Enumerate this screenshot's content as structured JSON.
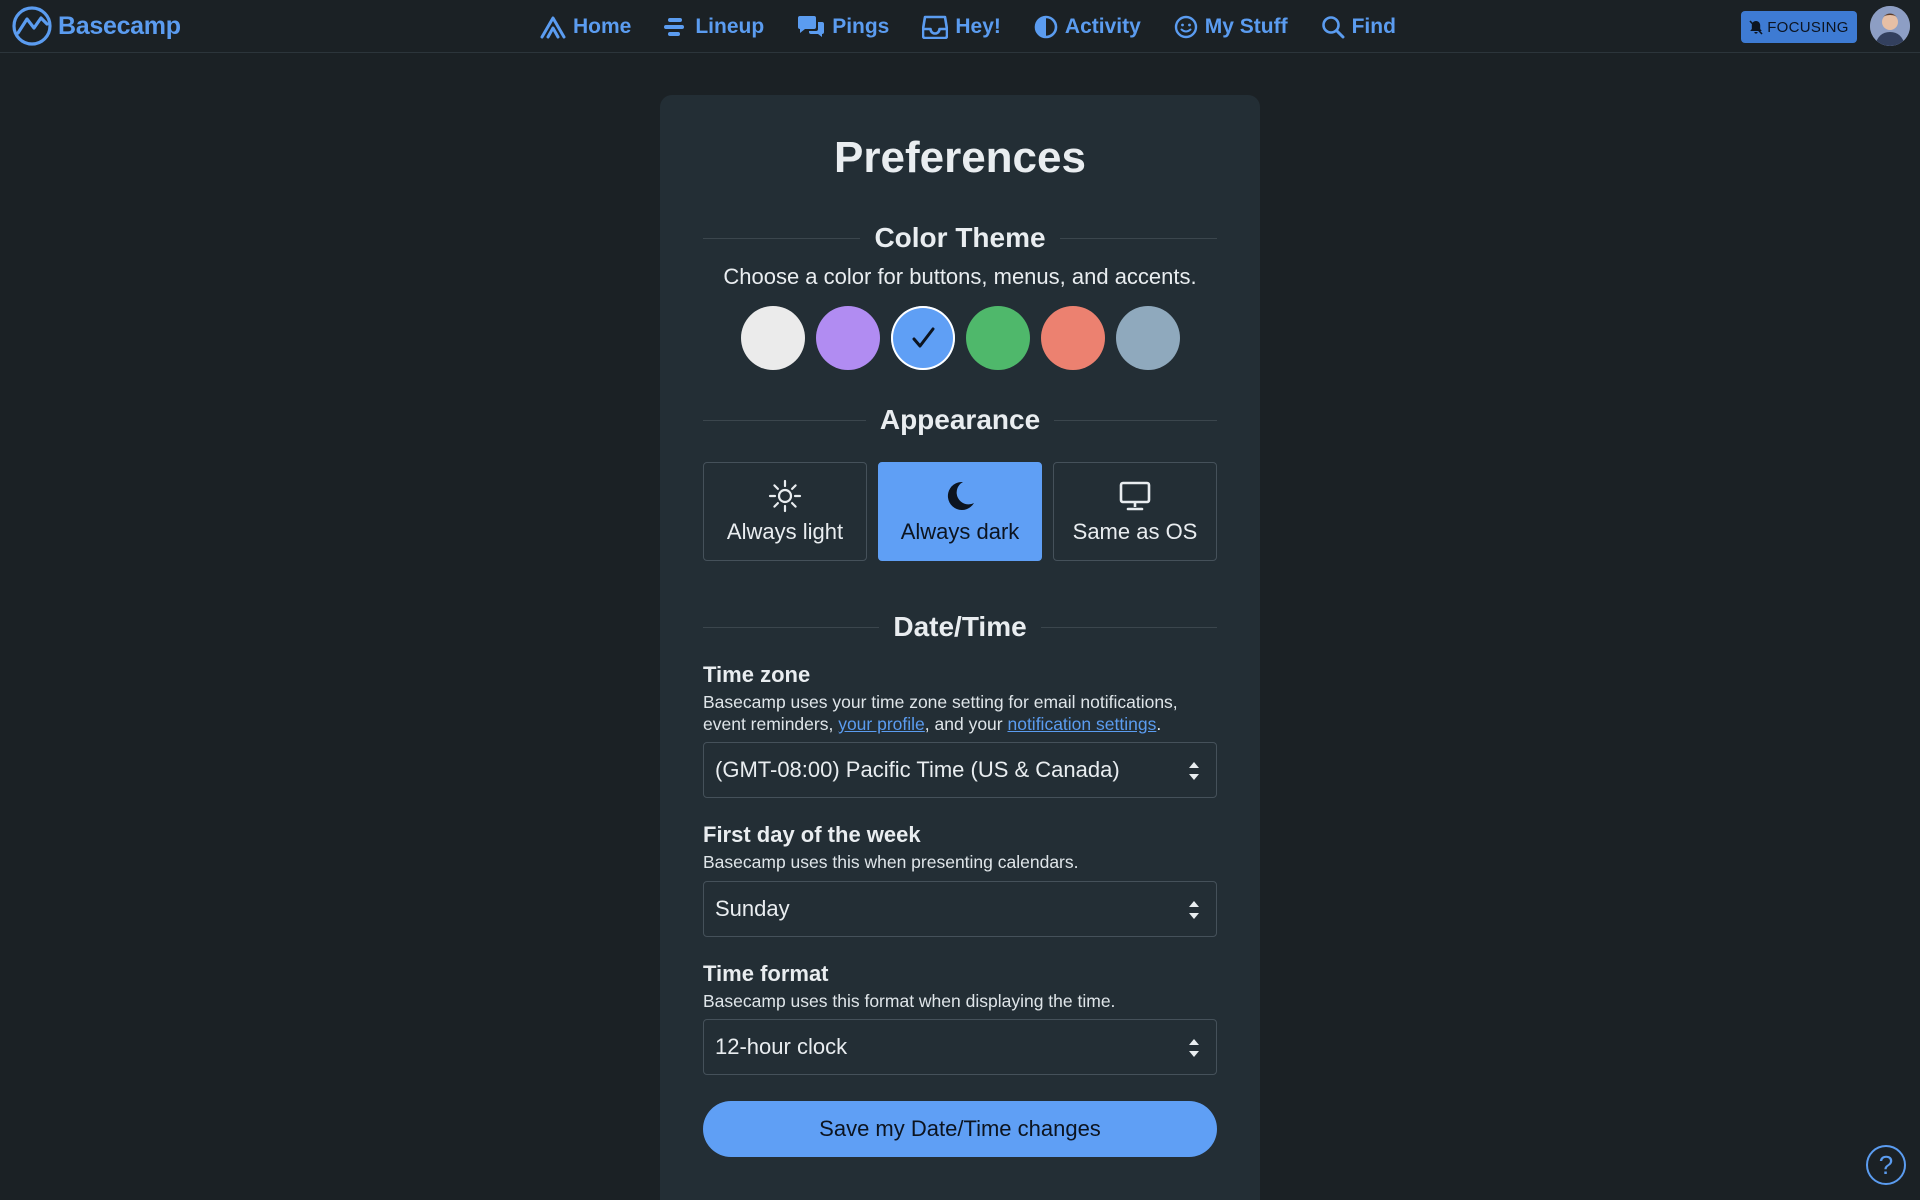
{
  "brand": {
    "name": "Basecamp",
    "icon": "basecamp-logo-icon"
  },
  "nav": {
    "items": [
      {
        "label": "Home",
        "icon": "home-icon"
      },
      {
        "label": "Lineup",
        "icon": "lineup-icon"
      },
      {
        "label": "Pings",
        "icon": "pings-icon"
      },
      {
        "label": "Hey!",
        "icon": "inbox-icon"
      },
      {
        "label": "Activity",
        "icon": "activity-icon"
      },
      {
        "label": "My Stuff",
        "icon": "smiley-icon"
      },
      {
        "label": "Find",
        "icon": "search-icon"
      }
    ],
    "focus_badge": "FOCUSING"
  },
  "page": {
    "title": "Preferences",
    "color_theme": {
      "heading": "Color Theme",
      "subtitle": "Choose a color for buttons, menus, and accents.",
      "swatches": [
        "#ebebeb",
        "#b18cf2",
        "#5f9ff5",
        "#4fb86b",
        "#ec8170",
        "#8fa9bd"
      ],
      "selected_index": 2
    },
    "appearance": {
      "heading": "Appearance",
      "options": [
        {
          "label": "Always light",
          "icon": "sun-icon"
        },
        {
          "label": "Always dark",
          "icon": "moon-icon"
        },
        {
          "label": "Same as OS",
          "icon": "monitor-icon"
        }
      ],
      "selected": "Always dark"
    },
    "datetime": {
      "heading": "Date/Time",
      "time_zone": {
        "label": "Time zone",
        "help_line1": "Basecamp uses your time zone setting for email notifications,",
        "help_prefix": "event reminders, ",
        "link_profile": "your profile",
        "help_middle": ", and your ",
        "link_notifications": "notification settings",
        "help_suffix": ".",
        "value": "(GMT-08:00) Pacific Time (US & Canada)"
      },
      "first_day": {
        "label": "First day of the week",
        "help": "Basecamp uses this when presenting calendars.",
        "value": "Sunday"
      },
      "time_format": {
        "label": "Time format",
        "help": "Basecamp uses this format when displaying the time.",
        "value": "12-hour clock"
      },
      "save_label": "Save my Date/Time changes"
    }
  },
  "help_button": "?",
  "colors": {
    "background": "#1b2125",
    "card": "#232e35",
    "accent": "#5f9ff5",
    "link": "#5b9cf0"
  }
}
